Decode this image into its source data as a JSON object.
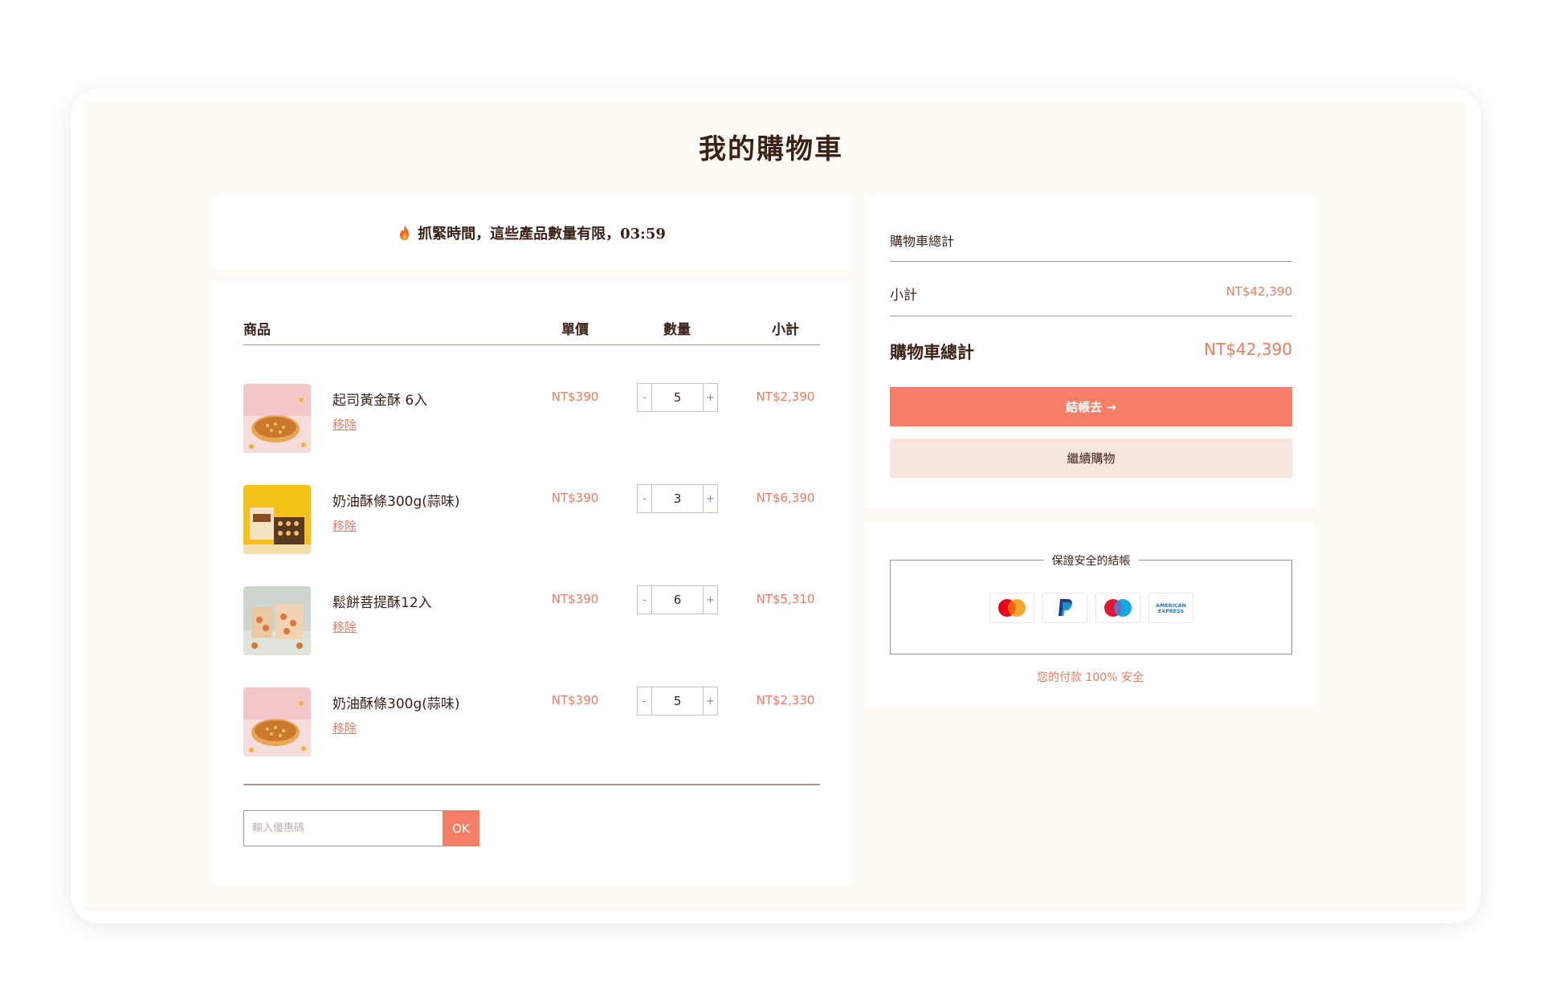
{
  "page": {
    "title": "我的購物車"
  },
  "timer": {
    "message": "抓緊時間，這些產品數量有限，",
    "time": "03:59"
  },
  "cart": {
    "columns": {
      "product": "商品",
      "price": "單價",
      "quantity": "數量",
      "subtotal": "小計"
    },
    "remove_label": "移除",
    "items": [
      {
        "name": "起司黃金酥 6入",
        "price": "NT$390",
        "quantity": "5",
        "subtotal": "NT$2,390"
      },
      {
        "name": "奶油酥條300g(蒜味)",
        "price": "NT$390",
        "quantity": "3",
        "subtotal": "NT$6,390"
      },
      {
        "name": "鬆餅菩提酥12入",
        "price": "NT$390",
        "quantity": "6",
        "subtotal": "NT$5,310"
      },
      {
        "name": "奶油酥條300g(蒜味)",
        "price": "NT$390",
        "quantity": "5",
        "subtotal": "NT$2,330"
      }
    ],
    "coupon": {
      "placeholder": "輸入優惠碼",
      "button_label": "OK"
    }
  },
  "summary": {
    "title": "購物車總計",
    "subtotal_label": "小計",
    "subtotal_value": "NT$42,390",
    "total_label": "購物車總計",
    "total_value": "NT$42,390",
    "checkout_label": "結帳去 →",
    "continue_label": "繼續購物"
  },
  "payment": {
    "title": "保證安全的結帳",
    "note": "您的付款 100% 安全",
    "icons": [
      "mastercard-icon",
      "paypal-icon",
      "maestro-icon",
      "amex-icon"
    ],
    "amex_text": [
      "AMERICAN",
      "EXPRESS"
    ]
  },
  "colors": {
    "accent": "#f47e66",
    "accent_text": "#ef7a5e",
    "soft": "#f6e6dd",
    "heading": "#3b2118",
    "background": "#fcfaf5"
  }
}
